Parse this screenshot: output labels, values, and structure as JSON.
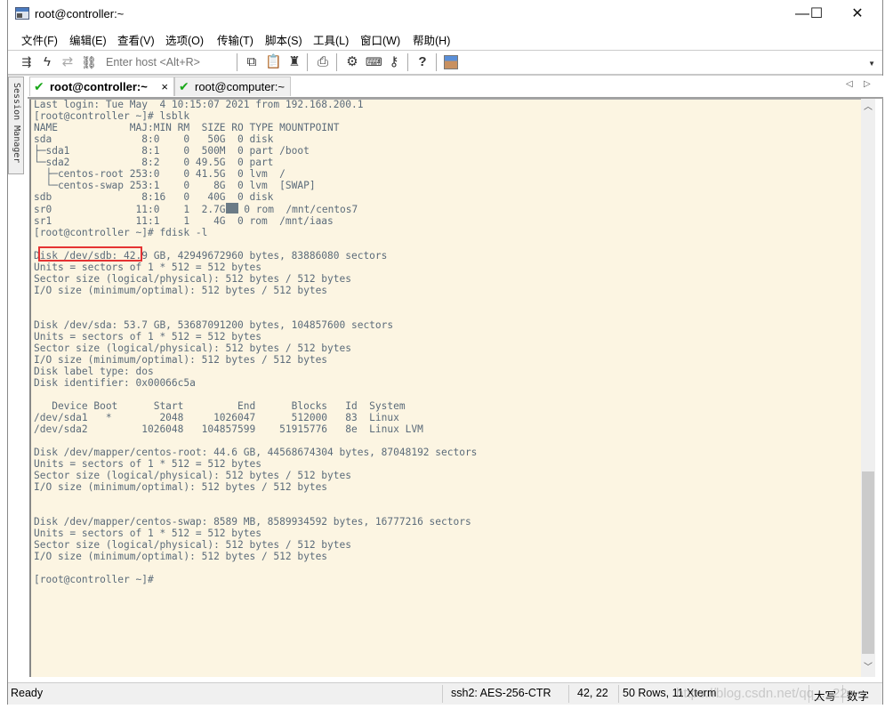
{
  "window": {
    "title": "root@controller:~",
    "minimize": "—",
    "maximize": "☐",
    "close": "✕"
  },
  "menu": [
    {
      "label": "文件(F)"
    },
    {
      "label": "编辑(E)"
    },
    {
      "label": "查看(V)"
    },
    {
      "label": "选项(O)"
    },
    {
      "label": "传输(T)"
    },
    {
      "label": "脚本(S)"
    },
    {
      "label": "工具(L)"
    },
    {
      "label": "窗口(W)"
    },
    {
      "label": "帮助(H)"
    }
  ],
  "toolbar": {
    "host_placeholder": "Enter host <Alt+R>",
    "icons": [
      "connect-bar-icon",
      "quick-connect-icon",
      "reconnect-icon",
      "disconnect-icon",
      "copy-icon",
      "paste-icon",
      "find-icon",
      "print-icon",
      "settings-icon",
      "keymap-icon",
      "key-icon",
      "help-icon",
      "secure-session-icon"
    ]
  },
  "session_manager": {
    "label": "Session Manager"
  },
  "tabs": [
    {
      "label": "root@controller:~",
      "active": true,
      "status": "connected",
      "close": "×"
    },
    {
      "label": "root@computer:~",
      "active": false,
      "status": "connected"
    }
  ],
  "terminal": {
    "lines": [
      "Last login: Tue May  4 10:15:07 2021 from 192.168.200.1",
      "[root@controller ~]# lsblk",
      "NAME            MAJ:MIN RM  SIZE RO TYPE MOUNTPOINT",
      "sda               8:0    0   50G  0 disk ",
      "├─sda1            8:1    0  500M  0 part /boot",
      "└─sda2            8:2    0 49.5G  0 part ",
      "  ├─centos-root 253:0    0 41.5G  0 lvm  /",
      "  └─centos-swap 253:1    0    8G  0 lvm  [SWAP]",
      "sdb               8:16   0   40G  0 disk ",
      "sr0              11:0    1  2.7G  0 rom  /mnt/centos7",
      "sr1              11:1    1    4G  0 rom  /mnt/iaas",
      "[root@controller ~]# fdisk -l",
      "",
      "Disk /dev/sdb: 42.9 GB, 42949672960 bytes, 83886080 sectors",
      "Units = sectors of 1 * 512 = 512 bytes",
      "Sector size (logical/physical): 512 bytes / 512 bytes",
      "I/O size (minimum/optimal): 512 bytes / 512 bytes",
      "",
      "",
      "Disk /dev/sda: 53.7 GB, 53687091200 bytes, 104857600 sectors",
      "Units = sectors of 1 * 512 = 512 bytes",
      "Sector size (logical/physical): 512 bytes / 512 bytes",
      "I/O size (minimum/optimal): 512 bytes / 512 bytes",
      "Disk label type: dos",
      "Disk identifier: 0x00066c5a",
      "",
      "   Device Boot      Start         End      Blocks   Id  System",
      "/dev/sda1   *        2048     1026047      512000   83  Linux",
      "/dev/sda2         1026048   104857599    51915776   8e  Linux LVM",
      "",
      "Disk /dev/mapper/centos-root: 44.6 GB, 44568674304 bytes, 87048192 sectors",
      "Units = sectors of 1 * 512 = 512 bytes",
      "Sector size (logical/physical): 512 bytes / 512 bytes",
      "I/O size (minimum/optimal): 512 bytes / 512 bytes",
      "",
      "",
      "Disk /dev/mapper/centos-swap: 8589 MB, 8589934592 bytes, 16777216 sectors",
      "Units = sectors of 1 * 512 = 512 bytes",
      "Sector size (logical/physical): 512 bytes / 512 bytes",
      "I/O size (minimum/optimal): 512 bytes / 512 bytes",
      "",
      "[root@controller ~]# "
    ],
    "highlight_text": "Disk /dev/sdb:",
    "highlight_color": "#e53333",
    "background": "#fcf5e2",
    "foreground": "#5b6b7a",
    "scroll_position": 0.66
  },
  "statusbar": {
    "status": "Ready",
    "encryption": "ssh2: AES-256-CTR",
    "cursor_pos": "42,  22",
    "dims": "50 Rows, 11 Xterm",
    "caps": "大写",
    "num": "数字"
  },
  "watermark": "https://blog.csdn.net/qq_...22"
}
